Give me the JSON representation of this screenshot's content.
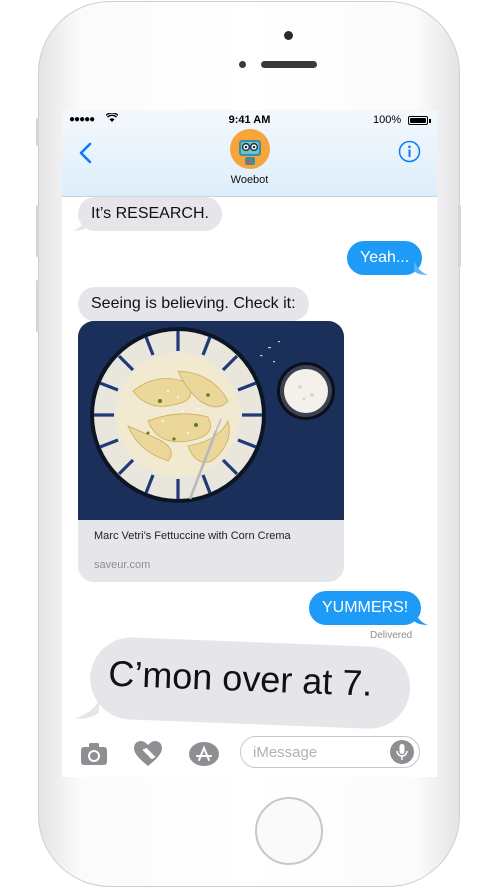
{
  "status_bar": {
    "time": "9:41 AM",
    "battery": "100%",
    "signal": "●●●●●",
    "wifi": "wifi-icon"
  },
  "contact": {
    "name": "Woebot"
  },
  "messages": {
    "m1": "It’s RESEARCH.",
    "m2": "Yeah...",
    "m3": "Seeing is believing. Check it:",
    "m4": "YUMMERS!",
    "m5": "C’mon over at 7."
  },
  "link_card": {
    "title": "Marc Vetri’s Fettuccine with Corn Crema",
    "url": "saveur.com"
  },
  "delivered": "Delivered",
  "input": {
    "placeholder": "iMessage"
  },
  "colors": {
    "outgoing": "#1d9bf6",
    "incoming": "#e5e5ea",
    "accent": "#0a7aff"
  },
  "icons": [
    "chevron-left-icon",
    "info-icon",
    "camera-icon",
    "digital-touch-icon",
    "app-store-icon",
    "microphone-icon"
  ]
}
